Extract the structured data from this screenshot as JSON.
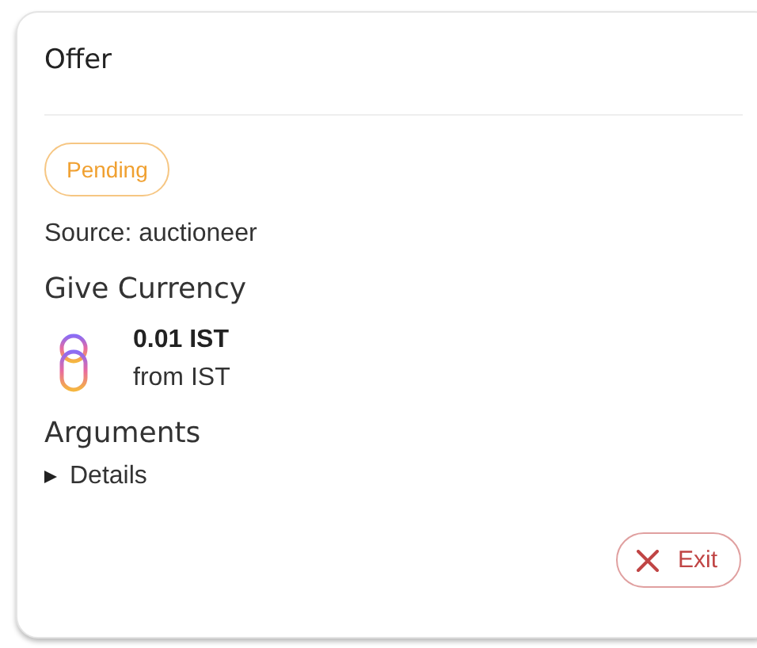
{
  "card": {
    "title": "Offer"
  },
  "status": {
    "label": "Pending",
    "kind": "pending"
  },
  "source": "Source: auctioneer",
  "give": {
    "heading": "Give Currency",
    "amount": "0.01 IST",
    "from": "from IST"
  },
  "arguments": {
    "heading": "Arguments",
    "details": {
      "label": "Details",
      "expanded": false
    }
  },
  "buttons": [
    {
      "label": "Exit",
      "kind": "exit"
    }
  ]
}
